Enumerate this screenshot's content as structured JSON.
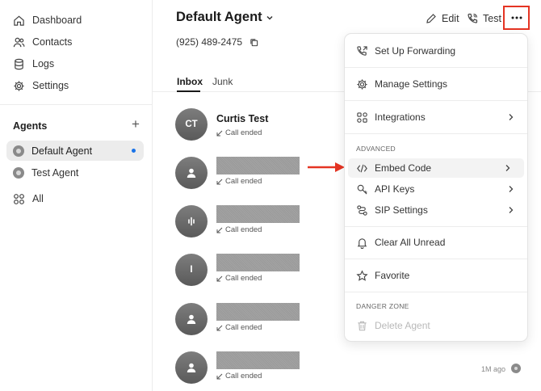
{
  "sidebar": {
    "nav": [
      {
        "label": "Dashboard",
        "icon": "home-icon"
      },
      {
        "label": "Contacts",
        "icon": "users-icon"
      },
      {
        "label": "Logs",
        "icon": "database-icon"
      },
      {
        "label": "Settings",
        "icon": "gear-icon"
      }
    ],
    "agents_heading": "Agents",
    "add_symbol": "+",
    "agents": [
      {
        "label": "Default Agent",
        "active": true,
        "unread": true
      },
      {
        "label": "Test Agent",
        "active": false,
        "unread": false
      }
    ],
    "all_label": "All"
  },
  "header": {
    "agent_name": "Default Agent",
    "phone": "(925) 489-2475",
    "edit_label": "Edit",
    "test_label": "Test"
  },
  "tabs": [
    "Inbox",
    "Junk"
  ],
  "calls": [
    {
      "initials": "CT",
      "name": "Curtis Test",
      "status": "Call ended",
      "avatar": "initials",
      "redacted": false
    },
    {
      "initials": "",
      "name": "",
      "status": "Call ended",
      "avatar": "person-icon",
      "redacted": true
    },
    {
      "initials": "",
      "name": "",
      "status": "Call ended",
      "avatar": "waveform-icon",
      "redacted": true
    },
    {
      "initials": "I",
      "name": "",
      "status": "Call ended",
      "avatar": "initials",
      "redacted": true
    },
    {
      "initials": "",
      "name": "",
      "status": "Call ended",
      "avatar": "person-icon",
      "redacted": true
    },
    {
      "initials": "",
      "name": "",
      "status": "Call ended",
      "avatar": "person-icon",
      "redacted": true
    }
  ],
  "last_call_time": "1M ago",
  "menu": {
    "items": [
      {
        "label": "Set Up Forwarding",
        "icon": "phone-forward-icon"
      },
      {
        "label": "Manage Settings",
        "icon": "gear-icon"
      },
      {
        "label": "Integrations",
        "icon": "integrations-icon"
      }
    ],
    "advanced_heading": "ADVANCED",
    "advanced": [
      {
        "label": "Embed Code",
        "icon": "code-icon"
      },
      {
        "label": "API Keys",
        "icon": "key-icon"
      },
      {
        "label": "SIP Settings",
        "icon": "sip-icon"
      }
    ],
    "clear_label": "Clear All Unread",
    "favorite_label": "Favorite",
    "danger_heading": "DANGER ZONE",
    "delete_label": "Delete Agent"
  },
  "colors": {
    "highlight_border": "#e53423",
    "unread_dot": "#1a73e8",
    "avatar_gray": "#6b6b6b"
  }
}
